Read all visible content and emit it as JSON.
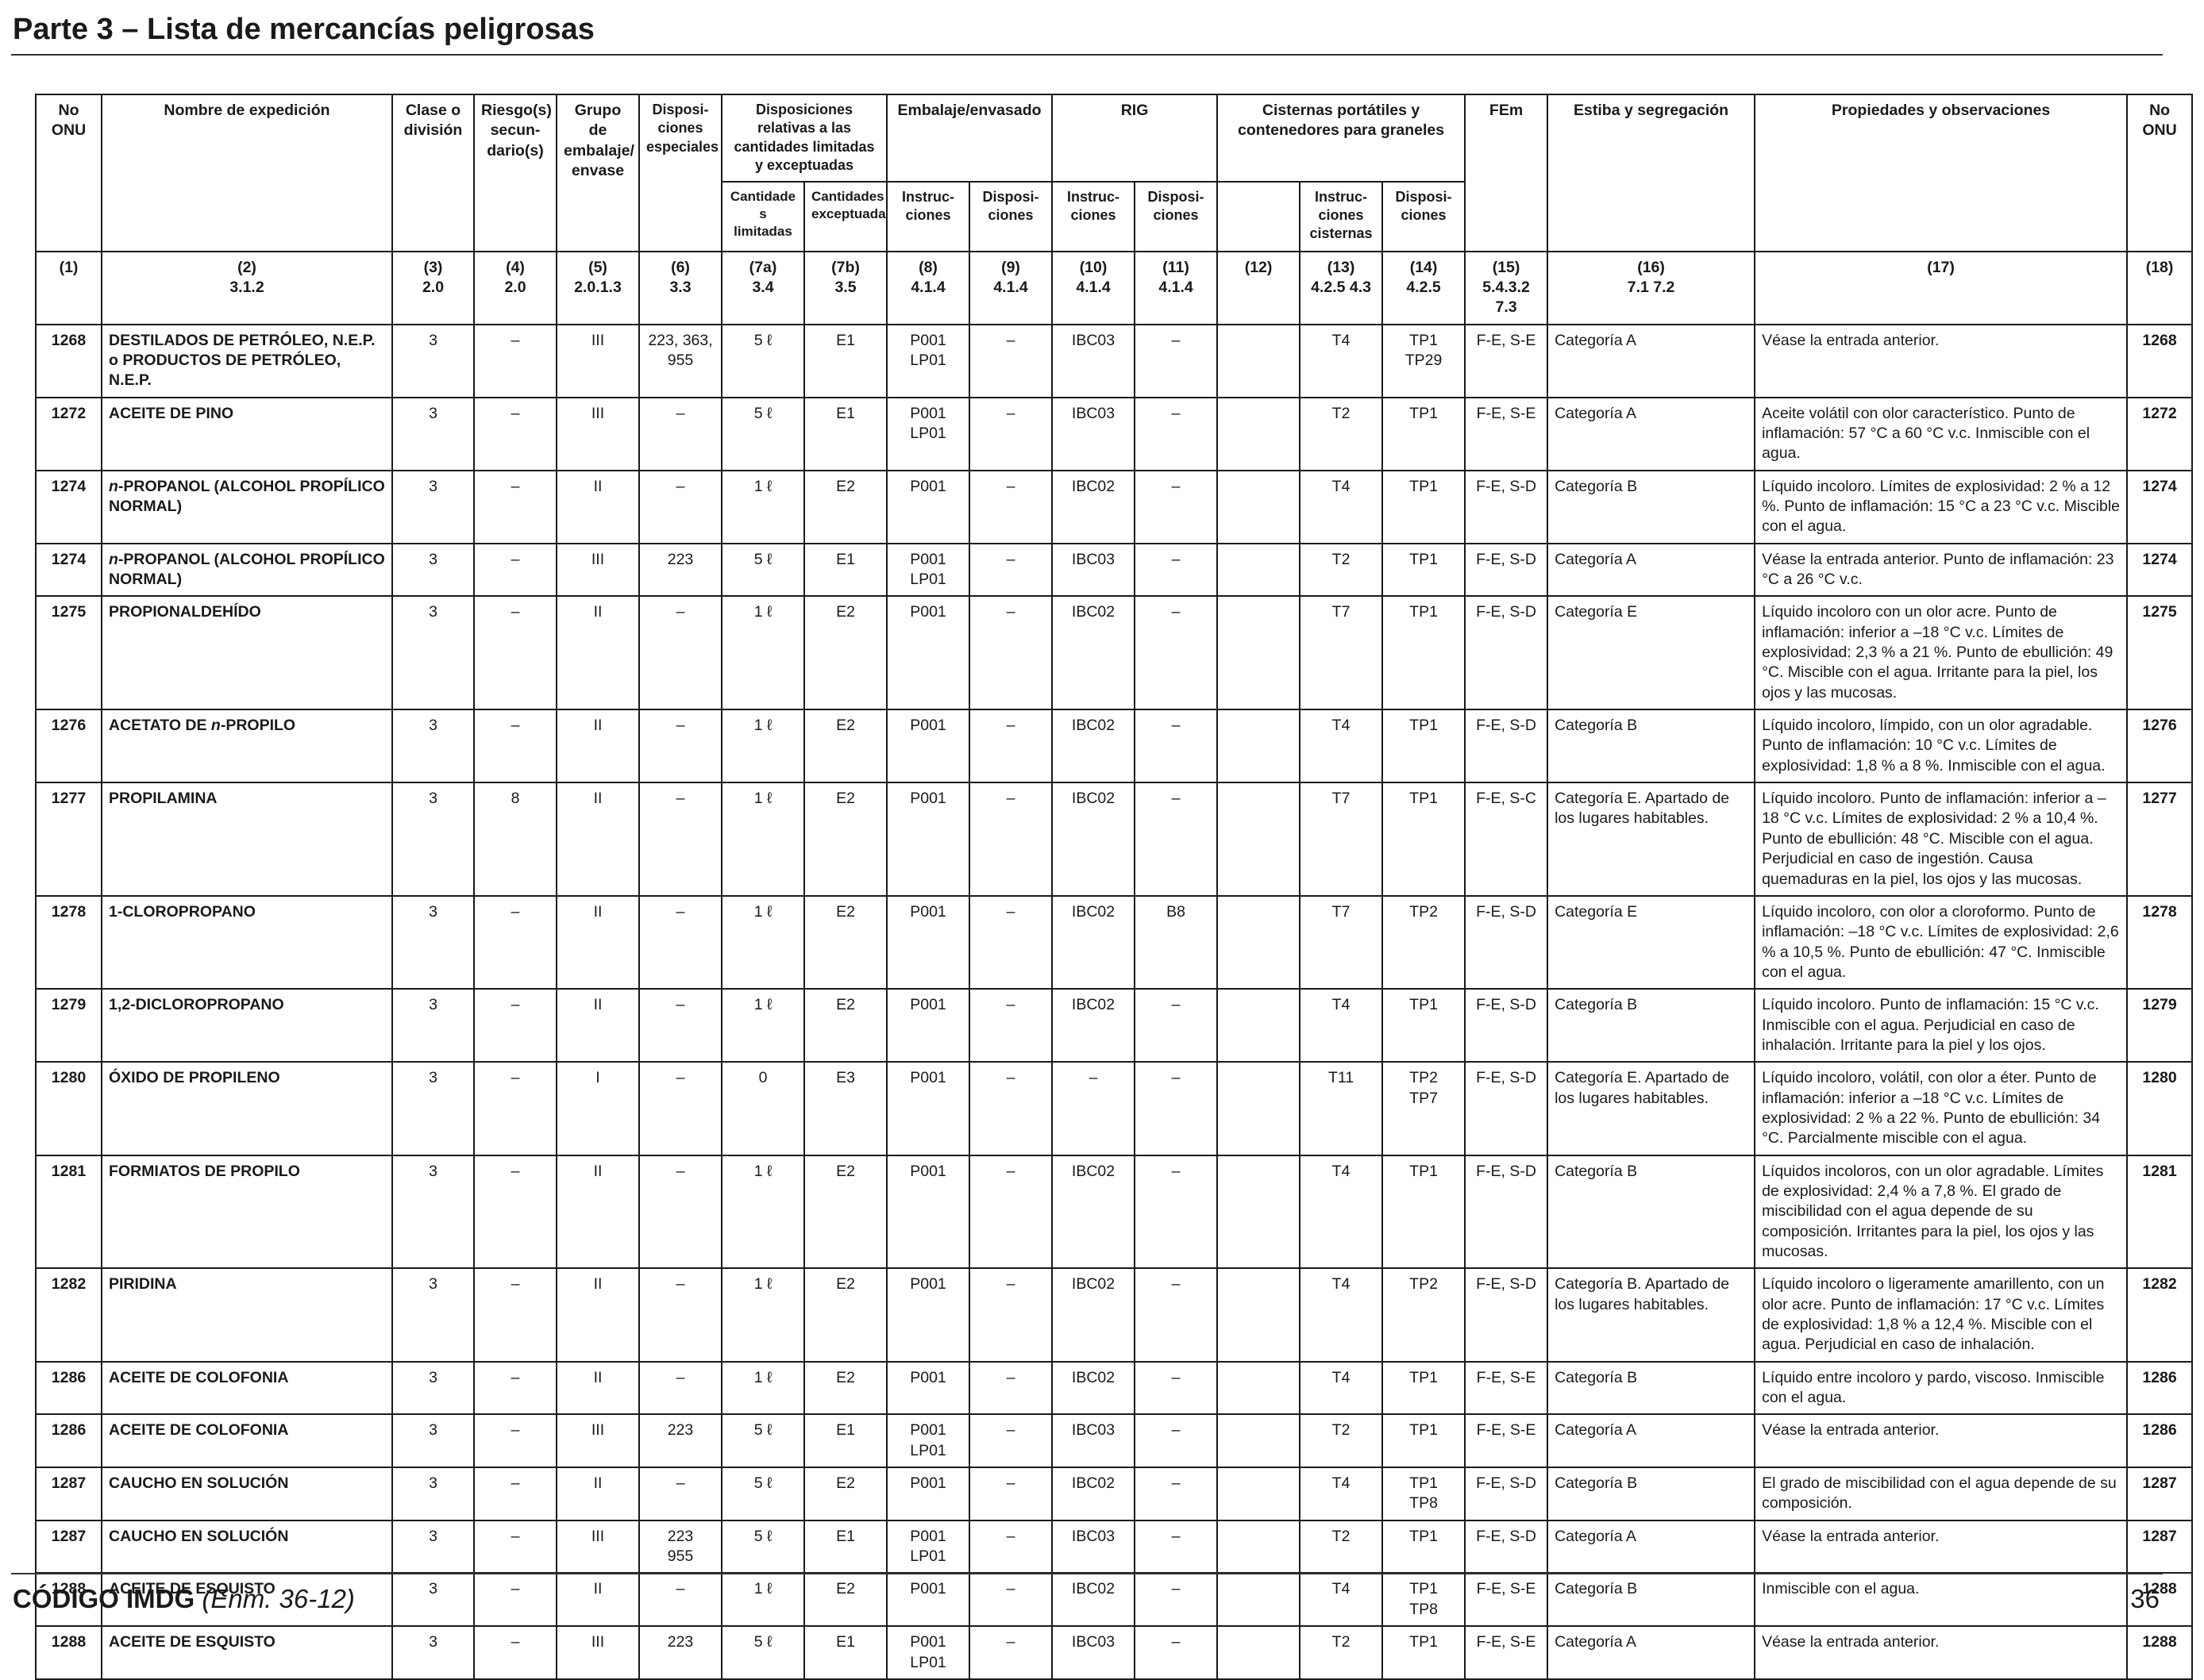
{
  "page_title": "Parte 3 – Lista de mercancías peligrosas",
  "headers": {
    "un_no": "No ONU",
    "shipping_name": "Nombre de expedición",
    "class": "Clase o división",
    "subsidiary_risk": "Riesgo(s) secun-dario(s)",
    "packing_group": "Grupo de embalaje/ envase",
    "special_provisions": "Disposi-ciones especiales",
    "limited_excepted": "Disposiciones relativas a las cantidades limitadas y exceptuadas",
    "limited_qty": "Cantidade s limitadas",
    "excepted_qty": "Cantidades exceptuadas",
    "packing": "Embalaje/envasado",
    "packing_instr": "Instruc-ciones",
    "packing_prov": "Disposi-ciones",
    "ibc": "RIG",
    "ibc_instr": "Instruc-ciones",
    "ibc_prov": "Disposi-ciones",
    "tanks": "Cisternas portátiles y contenedores para graneles",
    "tank_instr": "Instruc-ciones cisternas",
    "tank_prov": "Disposi-ciones",
    "ems": "FEm",
    "stowage": "Estiba y segregación",
    "properties": "Propiedades y observaciones",
    "un_no_right": "No ONU"
  },
  "column_refs": [
    {
      "n": "(1)",
      "s": ""
    },
    {
      "n": "(2)",
      "s": "3.1.2"
    },
    {
      "n": "(3)",
      "s": "2.0"
    },
    {
      "n": "(4)",
      "s": "2.0"
    },
    {
      "n": "(5)",
      "s": "2.0.1.3"
    },
    {
      "n": "(6)",
      "s": "3.3"
    },
    {
      "n": "(7a)",
      "s": "3.4"
    },
    {
      "n": "(7b)",
      "s": "3.5"
    },
    {
      "n": "(8)",
      "s": "4.1.4"
    },
    {
      "n": "(9)",
      "s": "4.1.4"
    },
    {
      "n": "(10)",
      "s": "4.1.4"
    },
    {
      "n": "(11)",
      "s": "4.1.4"
    },
    {
      "n": "(12)",
      "s": ""
    },
    {
      "n": "(13)",
      "s": "4.2.5 4.3"
    },
    {
      "n": "(14)",
      "s": "4.2.5"
    },
    {
      "n": "(15)",
      "s": "5.4.3.2 7.3"
    },
    {
      "n": "(16)",
      "s": "7.1 7.2"
    },
    {
      "n": "(17)",
      "s": ""
    },
    {
      "n": "(18)",
      "s": ""
    }
  ],
  "rows": [
    {
      "un": "1268",
      "name": "DESTILADOS DE PETRÓLEO, N.E.P. o PRODUCTOS DE PETRÓLEO, N.E.P.",
      "cls": "3",
      "sub": "–",
      "pg": "III",
      "sp": "223, 363, 955",
      "lq": "5 ℓ",
      "eq": "E1",
      "pi": "P001 LP01",
      "pp": "–",
      "ibc": "IBC03",
      "ibp": "–",
      "c12": "",
      "ti": "T4",
      "tp": "TP1 TP29",
      "ems": "F-E, S-E",
      "stow": "Categoría A",
      "prop": "Véase la entrada anterior.",
      "un2": "1268"
    },
    {
      "un": "1272",
      "name": "ACEITE DE PINO",
      "cls": "3",
      "sub": "–",
      "pg": "III",
      "sp": "–",
      "lq": "5 ℓ",
      "eq": "E1",
      "pi": "P001 LP01",
      "pp": "–",
      "ibc": "IBC03",
      "ibp": "–",
      "c12": "",
      "ti": "T2",
      "tp": "TP1",
      "ems": "F-E, S-E",
      "stow": "Categoría A",
      "prop": "Aceite volátil con olor característico. Punto de inflamación: 57 °C a 60 °C v.c. Inmiscible con el agua.",
      "un2": "1272"
    },
    {
      "un": "1274",
      "name": "n-PROPANOL (ALCOHOL PROPÍLICO NORMAL)",
      "cls": "3",
      "sub": "–",
      "pg": "II",
      "sp": "–",
      "lq": "1 ℓ",
      "eq": "E2",
      "pi": "P001",
      "pp": "–",
      "ibc": "IBC02",
      "ibp": "–",
      "c12": "",
      "ti": "T4",
      "tp": "TP1",
      "ems": "F-E, S-D",
      "stow": "Categoría B",
      "prop": "Líquido incoloro. Límites de explosividad: 2 % a 12 %. Punto de inflamación: 15 °C a 23 °C v.c. Miscible con el agua.",
      "un2": "1274"
    },
    {
      "un": "1274",
      "name": "n-PROPANOL (ALCOHOL PROPÍLICO NORMAL)",
      "cls": "3",
      "sub": "–",
      "pg": "III",
      "sp": "223",
      "lq": "5 ℓ",
      "eq": "E1",
      "pi": "P001 LP01",
      "pp": "–",
      "ibc": "IBC03",
      "ibp": "–",
      "c12": "",
      "ti": "T2",
      "tp": "TP1",
      "ems": "F-E, S-D",
      "stow": "Categoría A",
      "prop": "Véase la entrada anterior. Punto de inflamación: 23 °C a 26 °C v.c.",
      "un2": "1274"
    },
    {
      "un": "1275",
      "name": "PROPIONALDEHÍDO",
      "cls": "3",
      "sub": "–",
      "pg": "II",
      "sp": "–",
      "lq": "1 ℓ",
      "eq": "E2",
      "pi": "P001",
      "pp": "–",
      "ibc": "IBC02",
      "ibp": "–",
      "c12": "",
      "ti": "T7",
      "tp": "TP1",
      "ems": "F-E, S-D",
      "stow": "Categoría E",
      "prop": "Líquido incoloro con un olor acre. Punto de inflamación: inferior a –18 °C v.c. Límites de explosividad: 2,3 % a 21 %. Punto de ebullición: 49 °C. Miscible con el agua. Irritante para la piel, los ojos y las mucosas.",
      "un2": "1275"
    },
    {
      "un": "1276",
      "name": "ACETATO DE n-PROPILO",
      "cls": "3",
      "sub": "–",
      "pg": "II",
      "sp": "–",
      "lq": "1 ℓ",
      "eq": "E2",
      "pi": "P001",
      "pp": "–",
      "ibc": "IBC02",
      "ibp": "–",
      "c12": "",
      "ti": "T4",
      "tp": "TP1",
      "ems": "F-E, S-D",
      "stow": "Categoría B",
      "prop": "Líquido incoloro, límpido, con un olor agradable. Punto de inflamación: 10 °C v.c. Límites de explosividad: 1,8 % a 8 %. Inmiscible con el agua.",
      "un2": "1276"
    },
    {
      "un": "1277",
      "name": "PROPILAMINA",
      "cls": "3",
      "sub": "8",
      "pg": "II",
      "sp": "–",
      "lq": "1 ℓ",
      "eq": "E2",
      "pi": "P001",
      "pp": "–",
      "ibc": "IBC02",
      "ibp": "–",
      "c12": "",
      "ti": "T7",
      "tp": "TP1",
      "ems": "F-E, S-C",
      "stow": "Categoría E. Apartado de los lugares habitables.",
      "prop": "Líquido incoloro. Punto de inflamación: inferior a –18 °C v.c. Límites de explosividad: 2 % a 10,4 %. Punto de ebullición: 48 °C. Miscible con el agua. Perjudicial en caso de ingestión. Causa quemaduras en la piel, los ojos y las mucosas.",
      "un2": "1277"
    },
    {
      "un": "1278",
      "name": "1-CLOROPROPANO",
      "cls": "3",
      "sub": "–",
      "pg": "II",
      "sp": "–",
      "lq": "1 ℓ",
      "eq": "E2",
      "pi": "P001",
      "pp": "–",
      "ibc": "IBC02",
      "ibp": "B8",
      "c12": "",
      "ti": "T7",
      "tp": "TP2",
      "ems": "F-E, S-D",
      "stow": "Categoría E",
      "prop": "Líquido incoloro, con olor a cloroformo. Punto de inflamación: –18 °C v.c. Límites de explosividad: 2,6 % a 10,5 %. Punto de ebullición: 47 °C. Inmiscible con el agua.",
      "un2": "1278"
    },
    {
      "un": "1279",
      "name": "1,2-DICLOROPROPANO",
      "cls": "3",
      "sub": "–",
      "pg": "II",
      "sp": "–",
      "lq": "1 ℓ",
      "eq": "E2",
      "pi": "P001",
      "pp": "–",
      "ibc": "IBC02",
      "ibp": "–",
      "c12": "",
      "ti": "T4",
      "tp": "TP1",
      "ems": "F-E, S-D",
      "stow": "Categoría B",
      "prop": "Líquido incoloro. Punto de inflamación: 15 °C v.c. Inmiscible con el agua. Perjudicial en caso de inhalación. Irritante para la piel y los ojos.",
      "un2": "1279"
    },
    {
      "un": "1280",
      "name": "ÓXIDO DE PROPILENO",
      "cls": "3",
      "sub": "–",
      "pg": "I",
      "sp": "–",
      "lq": "0",
      "eq": "E3",
      "pi": "P001",
      "pp": "–",
      "ibc": "–",
      "ibp": "–",
      "c12": "",
      "ti": "T11",
      "tp": "TP2 TP7",
      "ems": "F-E, S-D",
      "stow": "Categoría E. Apartado de los lugares habitables.",
      "prop": "Líquido incoloro, volátil, con olor a éter. Punto de inflamación: inferior a –18 °C v.c. Límites de explosividad: 2 % a 22 %. Punto de ebullición: 34 °C. Parcialmente miscible con el agua.",
      "un2": "1280"
    },
    {
      "un": "1281",
      "name": "FORMIATOS DE PROPILO",
      "cls": "3",
      "sub": "–",
      "pg": "II",
      "sp": "–",
      "lq": "1 ℓ",
      "eq": "E2",
      "pi": "P001",
      "pp": "–",
      "ibc": "IBC02",
      "ibp": "–",
      "c12": "",
      "ti": "T4",
      "tp": "TP1",
      "ems": "F-E, S-D",
      "stow": "Categoría B",
      "prop": "Líquidos incoloros, con un olor agradable. Límites de explosividad: 2,4 % a 7,8 %. El grado de miscibilidad con el agua depende de su composición. Irritantes para la piel, los ojos y las mucosas.",
      "un2": "1281"
    },
    {
      "un": "1282",
      "name": "PIRIDINA",
      "cls": "3",
      "sub": "–",
      "pg": "II",
      "sp": "–",
      "lq": "1 ℓ",
      "eq": "E2",
      "pi": "P001",
      "pp": "–",
      "ibc": "IBC02",
      "ibp": "–",
      "c12": "",
      "ti": "T4",
      "tp": "TP2",
      "ems": "F-E, S-D",
      "stow": "Categoría B. Apartado de los lugares habitables.",
      "prop": "Líquido incoloro o ligeramente amarillento, con un olor acre. Punto de inflamación: 17 °C v.c. Límites de explosividad: 1,8 % a 12,4 %. Miscible con el agua. Perjudicial en caso de inhalación.",
      "un2": "1282"
    },
    {
      "un": "1286",
      "name": "ACEITE DE COLOFONIA",
      "cls": "3",
      "sub": "–",
      "pg": "II",
      "sp": "–",
      "lq": "1 ℓ",
      "eq": "E2",
      "pi": "P001",
      "pp": "–",
      "ibc": "IBC02",
      "ibp": "–",
      "c12": "",
      "ti": "T4",
      "tp": "TP1",
      "ems": "F-E, S-E",
      "stow": "Categoría B",
      "prop": "Líquido entre incoloro y pardo, viscoso. Inmiscible con el agua.",
      "un2": "1286"
    },
    {
      "un": "1286",
      "name": "ACEITE DE COLOFONIA",
      "cls": "3",
      "sub": "–",
      "pg": "III",
      "sp": "223",
      "lq": "5 ℓ",
      "eq": "E1",
      "pi": "P001 LP01",
      "pp": "–",
      "ibc": "IBC03",
      "ibp": "–",
      "c12": "",
      "ti": "T2",
      "tp": "TP1",
      "ems": "F-E, S-E",
      "stow": "Categoría A",
      "prop": "Véase la entrada anterior.",
      "un2": "1286"
    },
    {
      "un": "1287",
      "name": "CAUCHO EN SOLUCIÓN",
      "cls": "3",
      "sub": "–",
      "pg": "II",
      "sp": "–",
      "lq": "5 ℓ",
      "eq": "E2",
      "pi": "P001",
      "pp": "–",
      "ibc": "IBC02",
      "ibp": "–",
      "c12": "",
      "ti": "T4",
      "tp": "TP1 TP8",
      "ems": "F-E, S-D",
      "stow": "Categoría B",
      "prop": "El grado de miscibilidad con el agua depende de su composición.",
      "un2": "1287"
    },
    {
      "un": "1287",
      "name": "CAUCHO EN SOLUCIÓN",
      "cls": "3",
      "sub": "–",
      "pg": "III",
      "sp": "223 955",
      "lq": "5 ℓ",
      "eq": "E1",
      "pi": "P001 LP01",
      "pp": "–",
      "ibc": "IBC03",
      "ibp": "–",
      "c12": "",
      "ti": "T2",
      "tp": "TP1",
      "ems": "F-E, S-D",
      "stow": "Categoría A",
      "prop": "Véase la entrada anterior.",
      "un2": "1287"
    },
    {
      "un": "1288",
      "name": "ACEITE DE ESQUISTO",
      "cls": "3",
      "sub": "–",
      "pg": "II",
      "sp": "–",
      "lq": "1 ℓ",
      "eq": "E2",
      "pi": "P001",
      "pp": "–",
      "ibc": "IBC02",
      "ibp": "–",
      "c12": "",
      "ti": "T4",
      "tp": "TP1 TP8",
      "ems": "F-E, S-E",
      "stow": "Categoría B",
      "prop": "Inmiscible con el agua.",
      "un2": "1288"
    },
    {
      "un": "1288",
      "name": "ACEITE DE ESQUISTO",
      "cls": "3",
      "sub": "–",
      "pg": "III",
      "sp": "223",
      "lq": "5 ℓ",
      "eq": "E1",
      "pi": "P001 LP01",
      "pp": "–",
      "ibc": "IBC03",
      "ibp": "–",
      "c12": "",
      "ti": "T2",
      "tp": "TP1",
      "ems": "F-E, S-E",
      "stow": "Categoría A",
      "prop": "Véase la entrada anterior.",
      "un2": "1288"
    }
  ],
  "footer": {
    "code": "CÓDIGO IMDG",
    "amendment": "(Enm. 36-12)",
    "page": "36"
  }
}
